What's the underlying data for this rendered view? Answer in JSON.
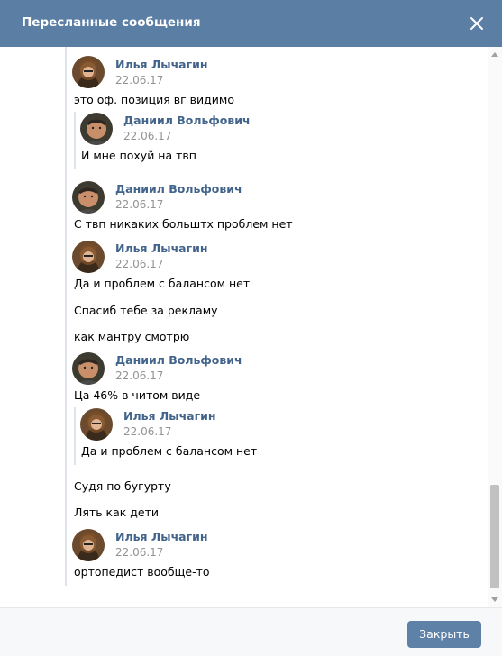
{
  "header": {
    "title": "Пересланные сообщения",
    "close_icon": "close-icon"
  },
  "messages": [
    {
      "author": "Илья Лычагин",
      "date": "22.06.17",
      "texts": [
        "это оф. позиция вг видимо"
      ],
      "quote": {
        "author": "Даниил Вольфович",
        "date": "22.06.17",
        "text": "И мне похуй на твп"
      }
    },
    {
      "author": "Даниил Вольфович",
      "date": "22.06.17",
      "texts": [
        "С твп никаких больштх проблем нет"
      ]
    },
    {
      "author": "Илья Лычагин",
      "date": "22.06.17",
      "texts": [
        "Да и проблем с балансом нет",
        "Спасиб тебе за рекламу",
        "как мантру смотрю"
      ]
    },
    {
      "author": "Даниил Вольфович",
      "date": "22.06.17",
      "texts": [
        "Ца 46% в читом виде"
      ],
      "quote": {
        "author": "Илья Лычагин",
        "date": "22.06.17",
        "text": "Да и проблем с балансом нет"
      }
    },
    {
      "texts": [
        "Судя по бугурту",
        "Лять как дети"
      ]
    },
    {
      "author": "Илья Лычагин",
      "date": "22.06.17",
      "texts": [
        "ортопедист вообще-то"
      ]
    }
  ],
  "footer": {
    "close_button": "Закрыть"
  },
  "colors": {
    "header_bg": "#5b7ea5",
    "author": "#42648b",
    "button_bg": "#5e81a8"
  }
}
